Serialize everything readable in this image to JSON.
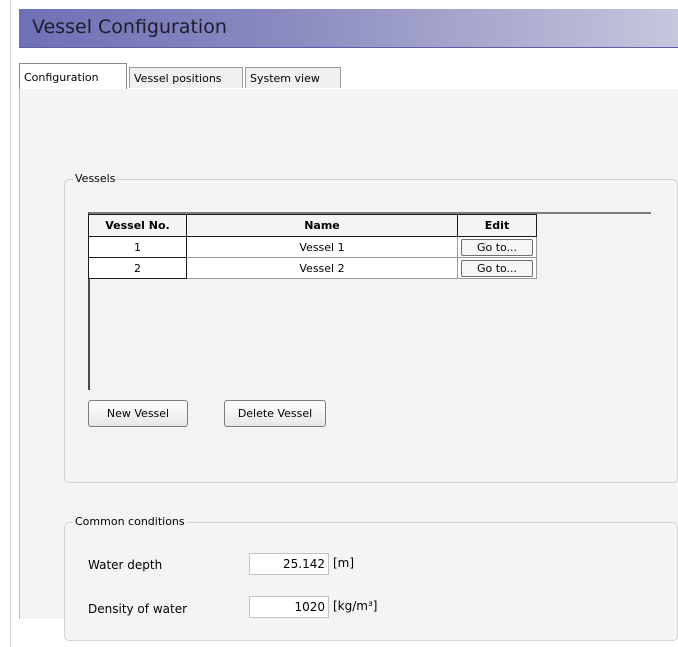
{
  "window": {
    "title": "Vessel Configuration"
  },
  "tabs": [
    {
      "label": "Configuration",
      "active": true
    },
    {
      "label": "Vessel positions",
      "active": false
    },
    {
      "label": "System view",
      "active": false
    }
  ],
  "vessels_group": {
    "legend": "Vessels",
    "columns": [
      "Vessel No.",
      "Name",
      "Edit"
    ],
    "rows": [
      {
        "number": "1",
        "name": "Vessel 1",
        "edit_label": "Go to..."
      },
      {
        "number": "2",
        "name": "Vessel 2",
        "edit_label": "Go to..."
      }
    ],
    "new_vessel_label": "New Vessel",
    "delete_vessel_label": "Delete Vessel"
  },
  "common_conditions": {
    "legend": "Common conditions",
    "water_depth": {
      "label": "Water depth",
      "value": "25.142",
      "unit": "[m]"
    },
    "water_density": {
      "label": "Density of water",
      "value": "1020",
      "unit": "[kg/m³]"
    }
  },
  "colors": {
    "title_bar_start": "#6f6fb6",
    "title_bar_end": "#c6c6dd",
    "panel_bg": "#f4f4f4"
  }
}
